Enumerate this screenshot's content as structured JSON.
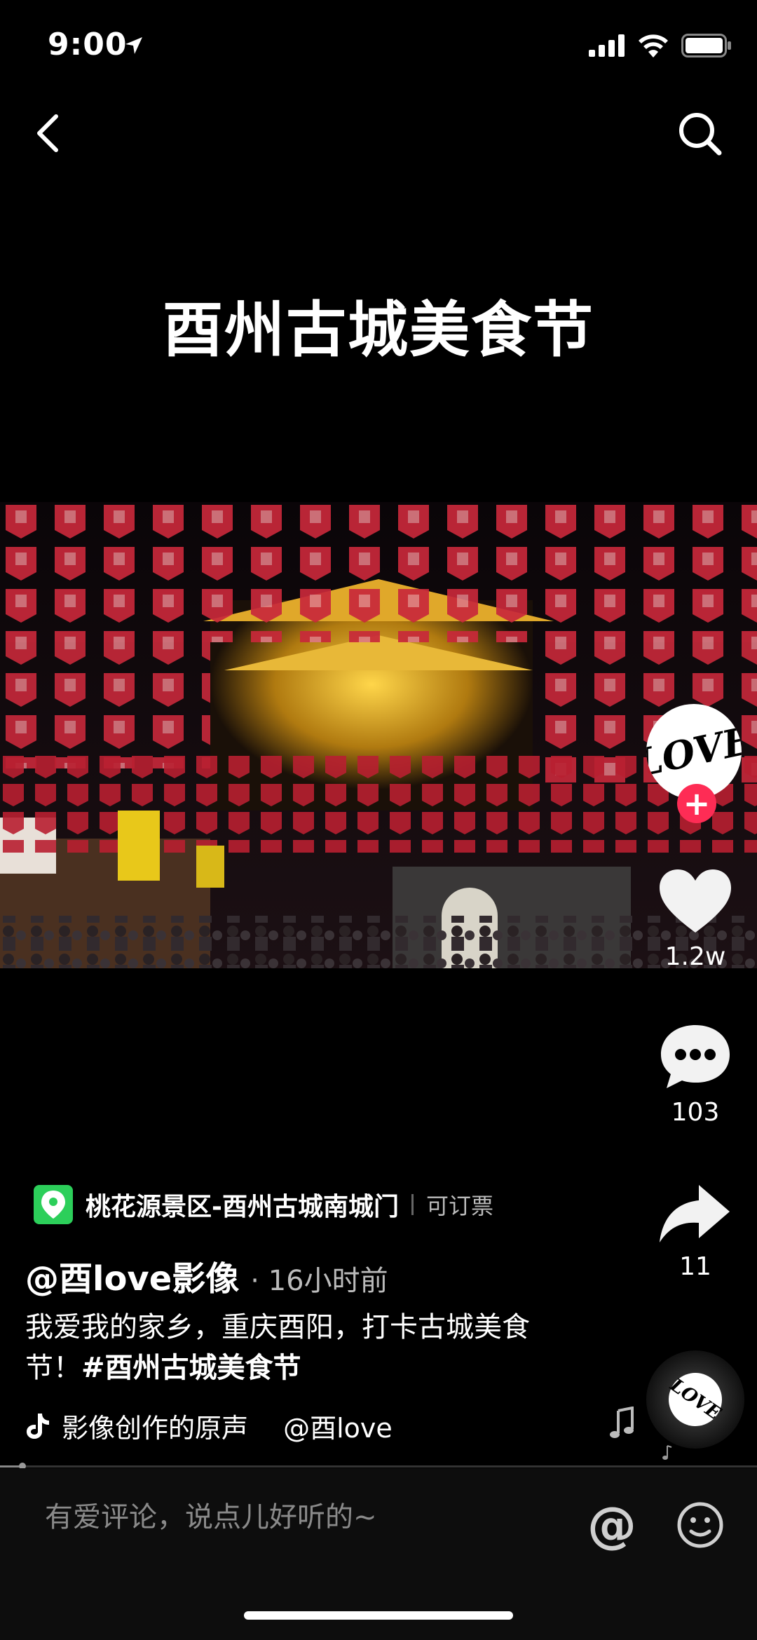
{
  "status": {
    "time": "9:00"
  },
  "video": {
    "title": "酉州古城美食节"
  },
  "creator": {
    "avatar_text": "LOVE",
    "follow_symbol": "+"
  },
  "stats": {
    "likes": "1.2w",
    "comments": "103",
    "shares": "11"
  },
  "location": {
    "name": "桃花源景区-酉州古城南城门",
    "extra": "可订票"
  },
  "post": {
    "author": "@酉love影像",
    "time": "· 16小时前",
    "desc": "我爱我的家乡，重庆酉阳，打卡古城美食节！",
    "hashtag": "#酉州古城美食节"
  },
  "music": {
    "text": "影像创作的原声　 @酉love",
    "disc_text": "LOVE"
  },
  "progress": {
    "fraction": 0.03
  },
  "comment_bar": {
    "placeholder": "有爱评论，说点儿好听的~",
    "at_label": "@"
  },
  "colors": {
    "accent": "#fe2c55",
    "location_green": "#2ccf5a"
  },
  "icons": [
    "location-arrow-icon",
    "signal-icon",
    "wifi-icon",
    "battery-icon",
    "back-icon",
    "search-icon",
    "heart-icon",
    "comment-icon",
    "share-icon",
    "music-note-icon",
    "tiktok-icon",
    "emoji-icon",
    "map-pin-icon"
  ]
}
